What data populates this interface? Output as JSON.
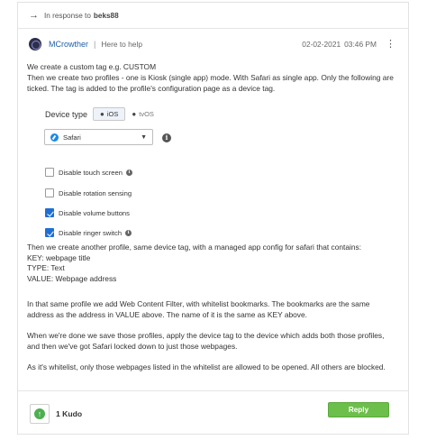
{
  "response": {
    "prefix": "In response to",
    "user": "beks88"
  },
  "post": {
    "author": "MCrowther",
    "separator": "|",
    "role": "Here to help",
    "date": "02-02-2021",
    "time": "03:46 PM",
    "menu_glyph": "⋮"
  },
  "body": {
    "p1_line1": "We create a custom tag e.g. CUSTOM",
    "p1_line2": "Then we create two profiles - one is Kiosk (single app) mode. With Safari as single app. Only the following are ticked. The tag is added to the profile's configuration page as a device tag.",
    "device_type_label": "Device type",
    "ios_label": "iOS",
    "tvos_label": "tvOS",
    "select_value": "Safari",
    "checkboxes": [
      {
        "label": "Disable touch screen",
        "checked": false,
        "info": true
      },
      {
        "label": "Disable rotation sensing",
        "checked": false,
        "info": false
      },
      {
        "label": "Disable volume buttons",
        "checked": true,
        "info": false
      },
      {
        "label": "Disable ringer switch",
        "checked": true,
        "info": true
      }
    ],
    "p2_line1": "Then we create another profile, same device tag, with a managed app config for safari that contains:",
    "p2_line2": "KEY: webpage title",
    "p2_line3": "TYPE: Text",
    "p2_line4": "VALUE: Webpage address",
    "p3": "In that same profile we add Web Content Filter, with whitelist bookmarks. The bookmarks are the same address as the address in VALUE above. The name of it is the same as KEY above.",
    "p4": "When we're done we save those profiles, apply the device tag to the device which adds both those profiles, and then we've got Safari locked down to just those webpages.",
    "p5": "As it's whitelist, only those webpages listed in the whitelist are allowed to be opened. All others are blocked."
  },
  "footer": {
    "kudo_count": "1 Kudo",
    "reply_label": "Reply"
  },
  "colors": {
    "author_link": "#1f5fa8",
    "reply_button": "#6cbf4a",
    "kudo_icon": "#4caf50",
    "checkbox_checked": "#1f6ed4"
  }
}
